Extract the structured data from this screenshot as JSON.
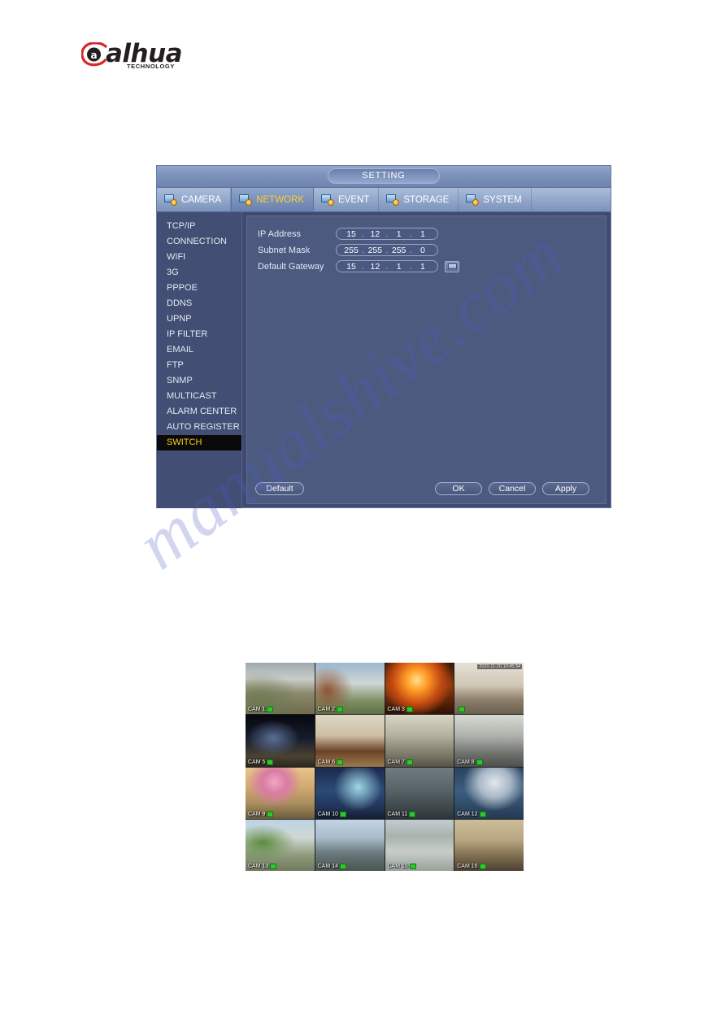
{
  "logo": {
    "wordmark": "alhua",
    "tagline": "TECHNOLOGY"
  },
  "watermark": {
    "text": "manualshive.com"
  },
  "dialog": {
    "title": "SETTING",
    "tabs": [
      {
        "label": "CAMERA",
        "icon": "camera-icon",
        "selected": false
      },
      {
        "label": "NETWORK",
        "icon": "network-icon",
        "selected": true
      },
      {
        "label": "EVENT",
        "icon": "event-icon",
        "selected": false
      },
      {
        "label": "STORAGE",
        "icon": "storage-icon",
        "selected": false
      },
      {
        "label": "SYSTEM",
        "icon": "system-icon",
        "selected": false
      }
    ],
    "sidebar": {
      "items": [
        {
          "label": "TCP/IP",
          "selected": false
        },
        {
          "label": "CONNECTION",
          "selected": false
        },
        {
          "label": "WIFI",
          "selected": false
        },
        {
          "label": "3G",
          "selected": false
        },
        {
          "label": "PPPOE",
          "selected": false
        },
        {
          "label": "DDNS",
          "selected": false
        },
        {
          "label": "UPNP",
          "selected": false
        },
        {
          "label": "IP FILTER",
          "selected": false
        },
        {
          "label": "EMAIL",
          "selected": false
        },
        {
          "label": "FTP",
          "selected": false
        },
        {
          "label": "SNMP",
          "selected": false
        },
        {
          "label": "MULTICAST",
          "selected": false
        },
        {
          "label": "ALARM CENTER",
          "selected": false
        },
        {
          "label": "AUTO REGISTER",
          "selected": false
        },
        {
          "label": "SWITCH",
          "selected": true
        }
      ]
    },
    "fields": [
      {
        "label": "IP Address",
        "octets": [
          "15",
          "12",
          "1",
          "1"
        ],
        "has_keyboard_button": false
      },
      {
        "label": "Subnet Mask",
        "octets": [
          "255",
          "255",
          "255",
          "0"
        ],
        "has_keyboard_button": false
      },
      {
        "label": "Default Gateway",
        "octets": [
          "15",
          "12",
          "1",
          "1"
        ],
        "has_keyboard_button": true
      }
    ],
    "buttons": {
      "default": "Default",
      "ok": "OK",
      "cancel": "Cancel",
      "apply": "Apply"
    },
    "colors": {
      "window_bg": "#3f4a6e",
      "content_bg": "#4d5a80",
      "titlebar": "#7e94bd",
      "selected_text": "#ffcc33",
      "selected_menu_bg": "#0a0a0a",
      "text": "#e4eaf5"
    }
  },
  "camera_grid": {
    "rows": 4,
    "columns": 4,
    "cells": [
      {
        "label": "CAM 1",
        "recording": true,
        "timestamp": ""
      },
      {
        "label": "CAM 2",
        "recording": true,
        "timestamp": ""
      },
      {
        "label": "CAM 3",
        "recording": true,
        "timestamp": ""
      },
      {
        "label": "",
        "recording": true,
        "timestamp": "2020-11-20 10:45:34"
      },
      {
        "label": "CAM 5",
        "recording": true,
        "timestamp": ""
      },
      {
        "label": "CAM 6",
        "recording": true,
        "timestamp": ""
      },
      {
        "label": "CAM 7",
        "recording": true,
        "timestamp": ""
      },
      {
        "label": "CAM 8",
        "recording": true,
        "timestamp": ""
      },
      {
        "label": "CAM 9",
        "recording": true,
        "timestamp": ""
      },
      {
        "label": "CAM 10",
        "recording": true,
        "timestamp": ""
      },
      {
        "label": "CAM 11",
        "recording": true,
        "timestamp": ""
      },
      {
        "label": "CAM 12",
        "recording": true,
        "timestamp": ""
      },
      {
        "label": "CAM 13",
        "recording": true,
        "timestamp": ""
      },
      {
        "label": "CAM 14",
        "recording": true,
        "timestamp": ""
      },
      {
        "label": "CAM 15",
        "recording": true,
        "timestamp": ""
      },
      {
        "label": "CAM 16",
        "recording": true,
        "timestamp": ""
      }
    ]
  }
}
